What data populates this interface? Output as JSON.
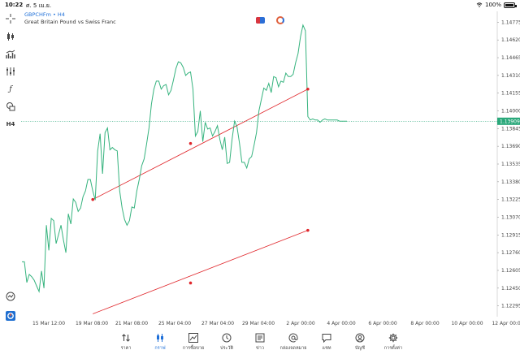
{
  "status_bar": {
    "time": "10:22",
    "date": "ศ. 5 เม.ย.",
    "battery": "100%"
  },
  "chart_header": {
    "symbol": "GBPCHFm",
    "separator": "•",
    "timeframe": "H4",
    "description": "Great Britain Pound vs Swiss Franc"
  },
  "left_toolbar": {
    "timeframe_label": "H4"
  },
  "colors": {
    "price_line": "#36b37e",
    "trend_line": "#e0262b",
    "current_price_tag": "#2aa87a",
    "active_tab": "#1e6fd8"
  },
  "chart_data": {
    "type": "line",
    "series": [
      {
        "x": [
          0,
          1,
          2,
          3,
          4,
          5,
          6,
          7,
          8,
          9,
          10,
          11,
          12,
          13,
          14,
          15,
          16,
          17,
          18,
          19,
          20,
          21,
          22,
          23,
          24,
          25,
          26,
          27,
          28,
          29,
          30,
          31,
          32,
          33,
          34,
          35,
          36,
          37,
          38,
          39,
          40,
          41,
          42,
          43,
          44,
          45,
          46,
          47,
          48,
          49,
          50,
          51,
          52,
          53,
          54,
          55,
          56,
          57,
          58,
          59,
          60,
          61,
          62,
          63,
          64,
          65,
          66,
          67,
          68,
          69,
          70,
          71,
          72,
          73,
          74,
          75,
          76,
          77,
          78,
          79,
          80,
          81,
          82,
          83,
          84,
          85,
          86,
          87,
          88,
          89,
          90,
          91,
          92,
          93,
          94,
          95,
          96,
          97,
          98,
          99,
          100,
          101,
          102,
          103,
          104,
          105,
          106,
          107,
          108,
          109,
          110,
          111,
          112,
          113,
          114,
          115,
          116,
          117,
          118,
          119,
          120,
          121,
          122,
          123,
          124,
          125,
          126,
          127,
          128,
          129,
          130,
          131,
          132,
          133
        ],
        "values": [
          1.1268,
          1.1268,
          1.125,
          1.1257,
          1.1255,
          1.1252,
          1.1247,
          1.1242,
          1.126,
          1.1245,
          1.13,
          1.1278,
          1.1306,
          1.1304,
          1.1284,
          1.1292,
          1.13,
          1.1287,
          1.1276,
          1.131,
          1.1301,
          1.1323,
          1.132,
          1.1312,
          1.1315,
          1.1325,
          1.133,
          1.134,
          1.134,
          1.133,
          1.1322,
          1.1365,
          1.138,
          1.1345,
          1.1381,
          1.1385,
          1.1366,
          1.1368,
          1.1366,
          1.1365,
          1.133,
          1.1315,
          1.1305,
          1.13,
          1.1304,
          1.1316,
          1.1315,
          1.133,
          1.134,
          1.1352,
          1.1358,
          1.1371,
          1.1385,
          1.1406,
          1.1419,
          1.1426,
          1.1426,
          1.1419,
          1.1422,
          1.1423,
          1.1414,
          1.1418,
          1.1427,
          1.1437,
          1.1443,
          1.1442,
          1.1438,
          1.1431,
          1.1433,
          1.1434,
          1.1419,
          1.1378,
          1.1382,
          1.14,
          1.1373,
          1.139,
          1.1384,
          1.1385,
          1.1378,
          1.1382,
          1.1387,
          1.1375,
          1.1366,
          1.1377,
          1.1354,
          1.1355,
          1.1375,
          1.1391,
          1.1386,
          1.1372,
          1.1355,
          1.1355,
          1.135,
          1.1358,
          1.136,
          1.137,
          1.1381,
          1.14,
          1.141,
          1.142,
          1.1418,
          1.1424,
          1.1416,
          1.143,
          1.1429,
          1.1421,
          1.1426,
          1.1425,
          1.1433,
          1.143,
          1.143,
          1.1432,
          1.1442,
          1.145,
          1.1465,
          1.1475,
          1.147,
          1.1395,
          1.1392,
          1.1393,
          1.1392,
          1.1392,
          1.139,
          1.1392,
          1.1393,
          1.1392,
          1.1392,
          1.1392,
          1.1392,
          1.1392,
          1.1391,
          1.1391,
          1.1391,
          1.1391
        ]
      }
    ],
    "trend_lines": [
      {
        "points": [
          {
            "x": 29,
            "y": 1.13225
          },
          {
            "x": 117,
            "y": 1.1419
          }
        ]
      },
      {
        "points": [
          {
            "x": 29,
            "y": 1.12225
          },
          {
            "x": 117,
            "y": 1.12955
          }
        ]
      }
    ],
    "markers": [
      {
        "x": 29,
        "y": 1.13225
      },
      {
        "x": 69,
        "y": 1.13715
      },
      {
        "x": 117,
        "y": 1.1419
      },
      {
        "x": 69,
        "y": 1.12495
      },
      {
        "x": 117,
        "y": 1.12955
      }
    ],
    "current_price": 1.13909,
    "x_tick_labels": [
      "15 Mar 12:00",
      "19 Mar 08:00",
      "21 Mar 08:00",
      "25 Mar 04:00",
      "27 Mar 04:00",
      "29 Mar 04:00",
      "2 Apr 00:00",
      "4 Apr 00:00",
      "6 Apr 00:00",
      "8 Apr 00:00",
      "10 Apr 00:00",
      "12 Apr 00:00"
    ],
    "y_tick_labels": [
      "1.14775",
      "1.14620",
      "1.14465",
      "1.14310",
      "1.14155",
      "1.14000",
      "1.13845",
      "1.13690",
      "1.13535",
      "1.13380",
      "1.13225",
      "1.13070",
      "1.12915",
      "1.12760",
      "1.12605",
      "1.12450",
      "1.12295"
    ],
    "ylim": [
      1.122,
      1.1487
    ],
    "grid": false
  },
  "bottom_nav": [
    {
      "label": "ราคา",
      "icon": "arrows-updown-icon"
    },
    {
      "label": "กราฟ",
      "icon": "candles-icon"
    },
    {
      "label": "การซื้อขาย",
      "icon": "trade-chart-icon"
    },
    {
      "label": "ประวัติ",
      "icon": "history-icon"
    },
    {
      "label": "ข่าว",
      "icon": "news-icon"
    },
    {
      "label": "กล่องจดหมาย",
      "icon": "at-icon"
    },
    {
      "label": "แชท",
      "icon": "chat-icon"
    },
    {
      "label": "บัญชี",
      "icon": "account-icon"
    },
    {
      "label": "การตั้งค่า",
      "icon": "gear-icon"
    }
  ]
}
